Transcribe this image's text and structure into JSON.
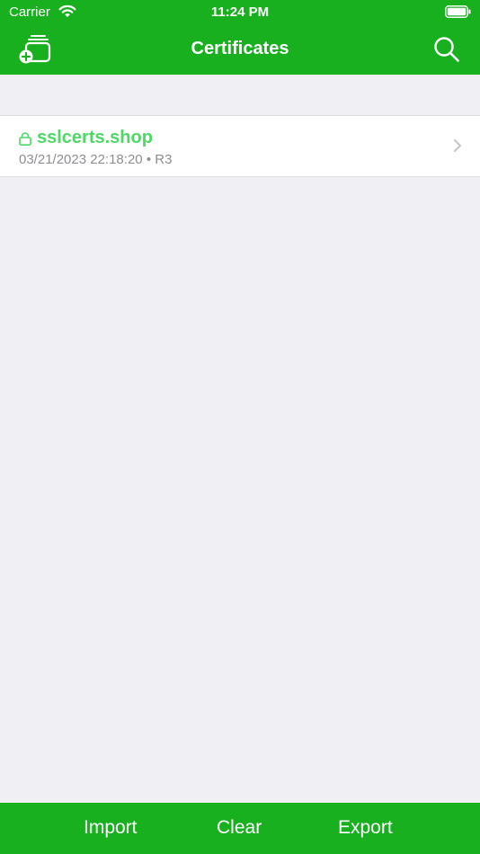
{
  "status_bar": {
    "carrier": "Carrier",
    "time": "11:24 PM",
    "wifi_icon": "wifi-icon",
    "battery_icon": "battery-icon"
  },
  "nav": {
    "title": "Certificates",
    "left_icon": "add-certificate-icon",
    "right_icon": "search-icon"
  },
  "certificates": [
    {
      "name": "sslcerts.shop",
      "date": "03/21/2023 22:18:20",
      "separator": "•",
      "issuer": "R3",
      "icon": "lock-icon"
    }
  ],
  "toolbar": {
    "import_label": "Import",
    "clear_label": "Clear",
    "export_label": "Export"
  },
  "colors": {
    "brand_green": "#18B01F",
    "title_green": "#4CD964",
    "background": "#EFEFF4",
    "secondary_text": "#8E8E93"
  }
}
